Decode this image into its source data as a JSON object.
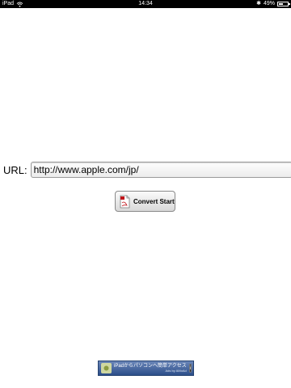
{
  "status_bar": {
    "device": "iPad",
    "time": "14:34",
    "battery": "49%"
  },
  "form": {
    "url_label": "URL:",
    "url_value": "http://www.apple.com/jp/"
  },
  "convert_button": {
    "label": "Convert Start",
    "icon": "pdf-document-icon"
  },
  "ad": {
    "text": "iPadからパソコンへ簡単アクセス",
    "sub": "Ads by AMoAd",
    "info": "i"
  }
}
